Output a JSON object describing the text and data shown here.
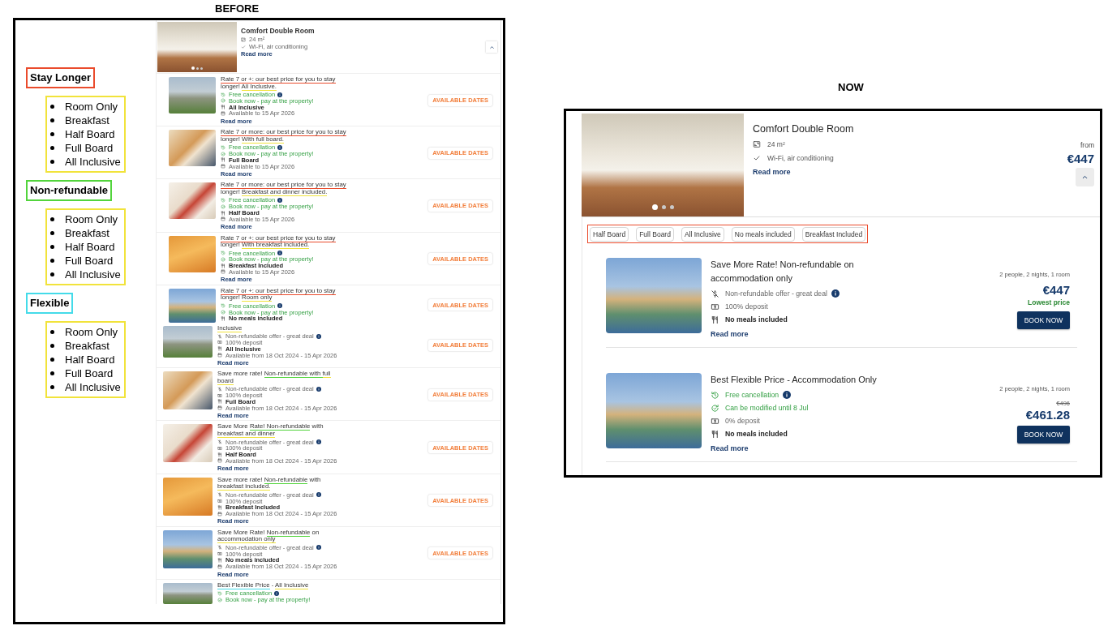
{
  "before": {
    "heading": "BEFORE",
    "categories": [
      {
        "label": "Stay Longer",
        "color": "#ea4b2c",
        "meals": {
          "color": "#f1e33b",
          "items": [
            "Room Only",
            "Breakfast",
            "Half Board",
            "Full Board",
            "All Inclusive"
          ]
        }
      },
      {
        "label": "Non-refundable",
        "color": "#52d43c",
        "meals": {
          "color": "#f1e33b",
          "items": [
            "Room Only",
            "Breakfast",
            "Half Board",
            "Full Board",
            "All Inclusive"
          ]
        }
      },
      {
        "label": "Flexible",
        "color": "#44dbe9",
        "meals": {
          "color": "#f1e33b",
          "items": [
            "Room Only",
            "Breakfast",
            "Half Board",
            "Full Board",
            "All Inclusive"
          ]
        }
      }
    ],
    "screenshots": [
      {
        "room": {
          "title": "Comfort Double Room",
          "area": "24 m²",
          "amenities": "Wi-Fi, air conditioning",
          "read_more": "Read more",
          "expanded": true,
          "photo_dots": [
            {
              "selected": true
            },
            {
              "selected": false
            },
            {
              "selected": false
            }
          ]
        },
        "rates": [
          {
            "photo": {
              "kind": "terrace"
            },
            "title": [
              {
                "text": "Rate 7 or +: our best price for you to stay",
                "color": "#ea4b2c"
              },
              {
                "text": " longer! "
              },
              {
                "text": "All Inclusive.",
                "color": "#f1e33b"
              }
            ],
            "features": [
              {
                "kind": "cancellation",
                "text": "Free cancellation",
                "info": true
              },
              {
                "kind": "pay-later",
                "text": "Book now - pay at the property!",
                "info": false
              },
              {
                "kind": "meal",
                "text": "All Inclusive",
                "info": false
              },
              {
                "kind": "availability",
                "text": "Available to 15 Apr 2026",
                "info": false
              }
            ],
            "read_more": "Read more",
            "button": "AVAILABLE DATES"
          },
          {
            "photo": {
              "kind": "buffet"
            },
            "title": [
              {
                "text": "Rate 7 or more: our best price for you to stay",
                "color": "#ea4b2c"
              },
              {
                "text": " longer! "
              },
              {
                "text": "With full board.",
                "color": "#f1e33b"
              }
            ],
            "features": [
              {
                "kind": "cancellation",
                "text": "Free cancellation",
                "info": true
              },
              {
                "kind": "pay-later",
                "text": "Book now - pay at the property!",
                "info": false
              },
              {
                "kind": "meal",
                "text": "Full Board",
                "info": false
              },
              {
                "kind": "availability",
                "text": "Available to 15 Apr 2026",
                "info": false
              }
            ],
            "read_more": "Read more",
            "button": "AVAILABLE DATES"
          },
          {
            "photo": {
              "kind": "dessert"
            },
            "title": [
              {
                "text": "Rate 7 or more: our best price for you to stay",
                "color": "#ea4b2c"
              },
              {
                "text": " longer! "
              },
              {
                "text": "Breakfast and dinner included.",
                "color": "#f1e33b"
              }
            ],
            "features": [
              {
                "kind": "cancellation",
                "text": "Free cancellation",
                "info": true
              },
              {
                "kind": "pay-later",
                "text": "Book now - pay at the property!",
                "info": false
              },
              {
                "kind": "meal",
                "text": "Half Board",
                "info": false
              },
              {
                "kind": "availability",
                "text": "Available to 15 Apr 2026",
                "info": false
              }
            ],
            "read_more": "Read more",
            "button": "AVAILABLE DATES"
          },
          {
            "photo": {
              "kind": "pastry"
            },
            "title": [
              {
                "text": "Rate 7 or +: our best price for you to stay",
                "color": "#ea4b2c"
              },
              {
                "text": " longer! "
              },
              {
                "text": "With breakfast included.",
                "color": "#f1e33b"
              }
            ],
            "features": [
              {
                "kind": "cancellation",
                "text": "Free cancellation",
                "info": true
              },
              {
                "kind": "pay-later",
                "text": "Book now - pay at the property!",
                "info": false
              },
              {
                "kind": "meal",
                "text": "Breakfast Included",
                "info": false
              },
              {
                "kind": "availability",
                "text": "Available to 15 Apr 2026",
                "info": false
              }
            ],
            "read_more": "Read more",
            "button": "AVAILABLE DATES"
          },
          {
            "photo": {
              "kind": "pool"
            },
            "title": [
              {
                "text": "Rate 7 or +: our best price for you to stay",
                "color": "#ea4b2c"
              },
              {
                "text": " longer! "
              },
              {
                "text": "Room only",
                "color": "#f1e33b"
              }
            ],
            "features": [
              {
                "kind": "cancellation",
                "text": "Free cancellation",
                "info": true
              },
              {
                "kind": "pay-later",
                "text": "Book now - pay at the property!",
                "info": false
              },
              {
                "kind": "meal",
                "text": "No meals included",
                "info": false
              }
            ],
            "button": "AVAILABLE DATES"
          }
        ]
      },
      {
        "rates": [
          {
            "photo": {
              "kind": "terrace"
            },
            "title": [
              {
                "text": "Inclusive",
                "color": "#f1e33b"
              }
            ],
            "features": [
              {
                "kind": "non-refundable",
                "text": "Non-refundable offer - great deal",
                "info": true
              },
              {
                "kind": "deposit",
                "text": "100% deposit",
                "info": false
              },
              {
                "kind": "meal",
                "text": "All Inclusive",
                "info": false
              },
              {
                "kind": "availability",
                "text": "Available from 18 Oct 2024 - 15 Apr 2026",
                "info": false
              }
            ],
            "read_more": "Read more",
            "button": "AVAILABLE DATES"
          },
          {
            "photo": {
              "kind": "buffet"
            },
            "title": [
              {
                "text": "Save more rate! "
              },
              {
                "text": "Non-refundable with ",
                "color": "#52d43c"
              },
              {
                "text": "full board",
                "color": "#f1e33b"
              }
            ],
            "features": [
              {
                "kind": "non-refundable",
                "text": "Non-refundable offer - great deal",
                "info": true
              },
              {
                "kind": "deposit",
                "text": "100% deposit",
                "info": false
              },
              {
                "kind": "meal",
                "text": "Full Board",
                "info": false
              },
              {
                "kind": "availability",
                "text": "Available from 18 Oct 2024 - 15 Apr 2026",
                "info": false
              }
            ],
            "read_more": "Read more",
            "button": "AVAILABLE DATES"
          },
          {
            "photo": {
              "kind": "dessert"
            },
            "title": [
              {
                "text": "Save More "
              },
              {
                "text": "Rate! Non-refundable",
                "color": "#52d43c"
              },
              {
                "text": " with "
              },
              {
                "text": "breakfast and dinner",
                "color": "#f1e33b"
              }
            ],
            "features": [
              {
                "kind": "non-refundable",
                "text": "Non-refundable offer - great deal",
                "info": true
              },
              {
                "kind": "deposit",
                "text": "100% deposit",
                "info": false
              },
              {
                "kind": "meal",
                "text": "Half Board",
                "info": false
              },
              {
                "kind": "availability",
                "text": "Available from 18 Oct 2024 - 15 Apr 2026",
                "info": false
              }
            ],
            "read_more": "Read more",
            "button": "AVAILABLE DATES"
          },
          {
            "photo": {
              "kind": "pastry"
            },
            "title": [
              {
                "text": "Save more rate! "
              },
              {
                "text": "Non-refundable",
                "color": "#52d43c"
              },
              {
                "text": " with "
              },
              {
                "text": "breakfast included.",
                "color": "#f1e33b"
              }
            ],
            "features": [
              {
                "kind": "non-refundable",
                "text": "Non-refundable offer - great deal",
                "info": true
              },
              {
                "kind": "deposit",
                "text": "100% deposit",
                "info": false
              },
              {
                "kind": "meal",
                "text": "Breakfast Included",
                "info": false
              },
              {
                "kind": "availability",
                "text": "Available from 18 Oct 2024 - 15 Apr 2026",
                "info": false
              }
            ],
            "read_more": "Read more",
            "button": "AVAILABLE DATES"
          },
          {
            "photo": {
              "kind": "pool"
            },
            "title": [
              {
                "text": "Save More Rate! "
              },
              {
                "text": "Non-refundable",
                "color": "#52d43c"
              },
              {
                "text": " on "
              },
              {
                "text": "accommodation only",
                "color": "#f1e33b"
              }
            ],
            "features": [
              {
                "kind": "non-refundable",
                "text": "Non-refundable offer - great deal",
                "info": true
              },
              {
                "kind": "deposit",
                "text": "100% deposit",
                "info": false
              },
              {
                "kind": "meal",
                "text": "No meals included",
                "info": false
              },
              {
                "kind": "availability",
                "text": "Available from 18 Oct 2024 - 15 Apr 2026",
                "info": false
              }
            ],
            "read_more": "Read more",
            "button": "AVAILABLE DATES"
          },
          {
            "photo": {
              "kind": "terrace"
            },
            "title": [
              {
                "text": "Best Flexible Price",
                "color": "#44dbe9"
              },
              {
                "text": " - "
              },
              {
                "text": "All Inclusive",
                "color": "#f1e33b"
              }
            ],
            "features": [
              {
                "kind": "cancellation",
                "text": "Free cancellation",
                "info": true
              },
              {
                "kind": "pay-later",
                "text": "Book now - pay at the property!",
                "info": false
              }
            ]
          }
        ]
      }
    ]
  },
  "now": {
    "heading": "NOW",
    "room": {
      "title": "Comfort Double Room",
      "area": "24 m²",
      "amenities": "Wi-Fi, air conditioning",
      "read_more": "Read more",
      "from": "from",
      "price": "€447",
      "expanded": true,
      "photo_dots": [
        {
          "selected": true
        },
        {
          "selected": false
        },
        {
          "selected": false
        }
      ]
    },
    "filters": {
      "color": "#ea4b2c",
      "chips": [
        {
          "label": "Half Board",
          "selected": false
        },
        {
          "label": "Full Board",
          "selected": false
        },
        {
          "label": "All Inclusive",
          "selected": false
        },
        {
          "label": "No meals included",
          "selected": false
        },
        {
          "label": "Breakfast Included",
          "selected": false
        }
      ]
    },
    "rates": [
      {
        "photo": {
          "kind": "pool"
        },
        "title": "Save More Rate! Non-refundable on accommodation only",
        "features": [
          {
            "kind": "non-refundable",
            "text": "Non-refundable offer - great deal",
            "info": true
          },
          {
            "kind": "deposit",
            "text": "100% deposit",
            "info": false
          },
          {
            "kind": "meal",
            "text": "No meals included",
            "info": false
          }
        ],
        "read_more": "Read more",
        "occupancy": "2 people, 2 nights, 1 room",
        "price": "€447",
        "note": "Lowest price",
        "button": "BOOK NOW"
      },
      {
        "photo": {
          "kind": "pool"
        },
        "title": "Best Flexible Price - Accommodation Only",
        "features": [
          {
            "kind": "cancellation",
            "text": "Free cancellation",
            "info": true
          },
          {
            "kind": "modifiable",
            "text": "Can be modified until 8 Jul",
            "info": false
          },
          {
            "kind": "deposit",
            "text": "0% deposit",
            "info": false
          },
          {
            "kind": "meal",
            "text": "No meals included",
            "info": false
          }
        ],
        "read_more": "Read more",
        "occupancy": "2 people, 2 nights, 1 room",
        "old_price": "€496",
        "price": "€461.28",
        "button": "BOOK NOW"
      }
    ]
  }
}
